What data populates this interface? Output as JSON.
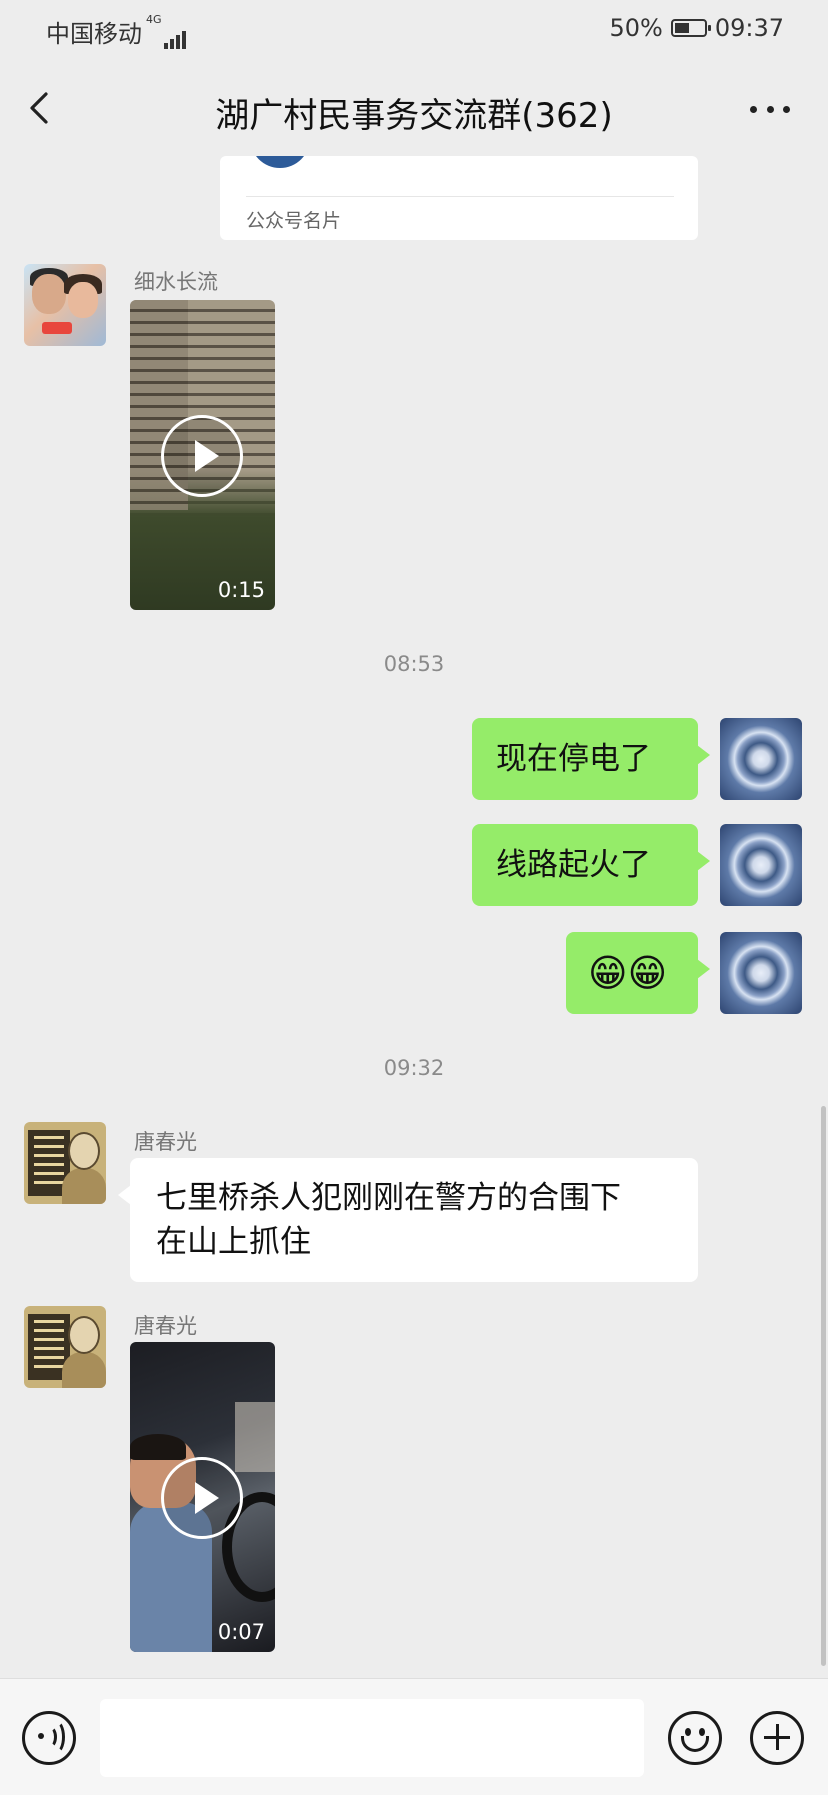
{
  "status_bar": {
    "carrier": "中国移动",
    "network": "4G",
    "battery": "50%",
    "battery_level": 0.5,
    "time": "09:37"
  },
  "header": {
    "title": "湖广村民事务交流群(362)"
  },
  "messages": {
    "card_label": "公众号名片",
    "video1": {
      "sender": "细水长流",
      "duration": "0:15"
    },
    "timestamp1": "08:53",
    "out1": "现在停电了",
    "out2": "线路起火了",
    "out3": "😁😁",
    "timestamp2": "09:32",
    "text_in": {
      "sender": "唐春光",
      "line1": "七里桥杀人犯刚刚在警方的合围下",
      "line2": "在山上抓住"
    },
    "video2": {
      "sender": "唐春光",
      "duration": "0:07"
    }
  },
  "input_bar": {
    "text_value": "",
    "icons": [
      "voice-icon",
      "emoji-icon",
      "plus-icon"
    ]
  },
  "colors": {
    "outgoing_bubble": "#95ec69",
    "incoming_bubble": "#ffffff",
    "background": "#ededed"
  }
}
